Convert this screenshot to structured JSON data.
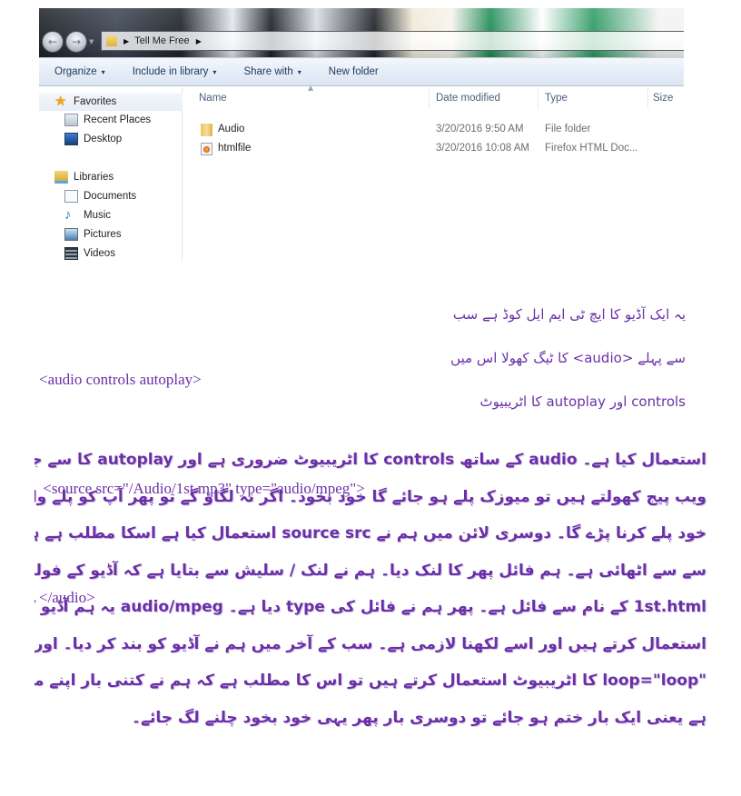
{
  "explorer": {
    "nav": {
      "back_icon": "back-arrow-icon",
      "forward_icon": "forward-arrow-icon",
      "recent_dropdown_icon": "chevron-down-icon"
    },
    "address_bar": {
      "folder_icon": "folder-icon",
      "breadcrumb": [
        "Tell Me Free"
      ],
      "separator_icon": "chevron-right-icon"
    },
    "toolbar": {
      "organize": "Organize",
      "include_in_library": "Include in library",
      "share_with": "Share with",
      "new_folder": "New folder",
      "dropdown_glyph": "▾"
    },
    "sidebar": {
      "favorites": {
        "label": "Favorites",
        "icon": "star-icon",
        "items": [
          {
            "label": "Recent Places",
            "icon": "recent-places-icon"
          },
          {
            "label": "Desktop",
            "icon": "desktop-icon"
          }
        ]
      },
      "libraries": {
        "label": "Libraries",
        "icon": "libraries-icon",
        "items": [
          {
            "label": "Documents",
            "icon": "documents-icon"
          },
          {
            "label": "Music",
            "icon": "music-icon"
          },
          {
            "label": "Pictures",
            "icon": "pictures-icon"
          },
          {
            "label": "Videos",
            "icon": "videos-icon"
          }
        ]
      }
    },
    "file_list": {
      "columns": [
        "Name",
        "Date modified",
        "Type",
        "Size"
      ],
      "sort_column": "Name",
      "rows": [
        {
          "name": "Audio",
          "date_modified": "3/20/2016 9:50 AM",
          "type": "File folder",
          "size": "",
          "icon": "folder-icon"
        },
        {
          "name": "htmlfile",
          "date_modified": "3/20/2016 10:08 AM",
          "type": "Firefox HTML Doc...",
          "size": "",
          "icon": "firefox-html-icon"
        }
      ]
    }
  },
  "article": {
    "text_color": "#6a30a7",
    "code_lines": [
      "<audio controls autoplay>",
      " <source src=\"/Audio/1st.mp3\" type=\"audio/mpeg\">",
      "</audio>"
    ],
    "side_note": [
      "یہ ایک آڈیو کا ایچ ٹی ایم ایل کوڈ ہے سب",
      "سے پہلے <audio> کا ٹیگ کھولا اس میں",
      "controls اور autoplay کا اٹریبیوٹ"
    ],
    "paragraph": [
      "استعمال کیا ہے۔ audio کے ساتھ controls کا اٹریبیوٹ ضروری ہے اور autoplay کا سے جیسے ہی آپ اپنا",
      "ویب پیج کھولتے ہیں تو میوزک پلے ہو جائے گا خود بخود۔ اگر نہ لگاؤ گے تو پھر آپ کو پلے والے بٹن پر کلک کر کے",
      "خود پلے کرنا پڑے گا۔ دوسری لائن میں ہم نے source src استعمال کیا ہے اسکا مطلب ہے ہم نے یہ فائل",
      "سے سے اٹھائی ہے۔ ہم فائل پھر کا لنک دیا۔ ہم نے لنک / سلیش سے بتایا ہے کہ آڈیو کے فولڈ میں جا کر",
      "1st.html کے نام سے فائل ہے۔ پھر ہم نے فائل کی type دیا ہے۔ audio/mpeg یہ ہم آڈیو کے لیے",
      "استعمال کرتے ہیں اور اسے لکھنا لازمی ہے۔ سب کے آخر میں ہم نے آڈیو کو بند کر دیا۔ اور اگر ہم",
      "\"loop=\"loop کا اٹریبیوٹ استعمال کرتے ہیں تو اس کا مطلب ہے کہ ہم نے کتنی بار اپنے میوزک کو ریپیٹ کرنا",
      "ہے یعنی ایک بار ختم ہو جائے تو دوسری بار پھر یہی خود بخود چلنے لگ جائے۔"
    ],
    "inline_terms": {
      "audio": "audio",
      "controls": "controls",
      "autoplay": "autoplay",
      "source_src": "source src",
      "html_file_num": "1",
      "html_file_sup": "st",
      "html_file_ext": ".html",
      "type": "type",
      "mime": "audio/mpeg",
      "loop": "loop=\"loop\"",
      "audio_tag": "<audio>"
    }
  }
}
